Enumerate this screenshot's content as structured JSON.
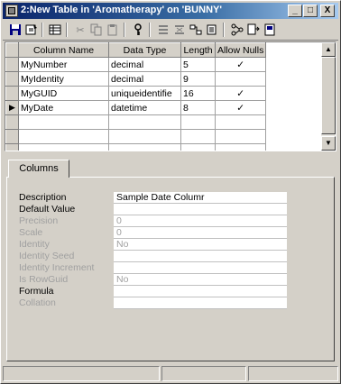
{
  "window": {
    "title": "2:New Table in 'Aromatherapy' on 'BUNNY'"
  },
  "title_buttons": [
    "_",
    "□",
    "X"
  ],
  "toolbar": {
    "icons": [
      "save-icon",
      "properties-icon",
      "table-icon",
      "cut-icon",
      "copy-icon",
      "paste-icon",
      "primary-key-icon",
      "insert-column-icon",
      "delete-column-icon",
      "relationships-icon",
      "indexes-icon",
      "constraints-icon",
      "generate-script-icon"
    ]
  },
  "grid": {
    "headers": [
      "Column Name",
      "Data Type",
      "Length",
      "Allow Nulls"
    ],
    "rows": [
      {
        "name": "MyNumber",
        "type": "decimal",
        "length": "5",
        "nulls": "✓"
      },
      {
        "name": "MyIdentity",
        "type": "decimal",
        "length": "9",
        "nulls": ""
      },
      {
        "name": "MyGUID",
        "type": "uniqueidentifie",
        "length": "16",
        "nulls": "✓"
      },
      {
        "name": "MyDate",
        "type": "datetime",
        "length": "8",
        "nulls": "✓"
      }
    ],
    "current_row_marker": "▶"
  },
  "columns_tab": {
    "label": "Columns"
  },
  "properties": [
    {
      "label": "Description",
      "value": "Sample Date Columr",
      "enabled": true
    },
    {
      "label": "Default Value",
      "value": "",
      "enabled": true
    },
    {
      "label": "Precision",
      "value": "0",
      "enabled": false
    },
    {
      "label": "Scale",
      "value": "0",
      "enabled": false
    },
    {
      "label": "Identity",
      "value": "No",
      "enabled": false
    },
    {
      "label": "Identity Seed",
      "value": "",
      "enabled": false
    },
    {
      "label": "Identity Increment",
      "value": "",
      "enabled": false
    },
    {
      "label": "Is RowGuid",
      "value": "No",
      "enabled": false
    },
    {
      "label": "Formula",
      "value": "",
      "enabled": true
    },
    {
      "label": "Collation",
      "value": "",
      "enabled": false
    }
  ]
}
